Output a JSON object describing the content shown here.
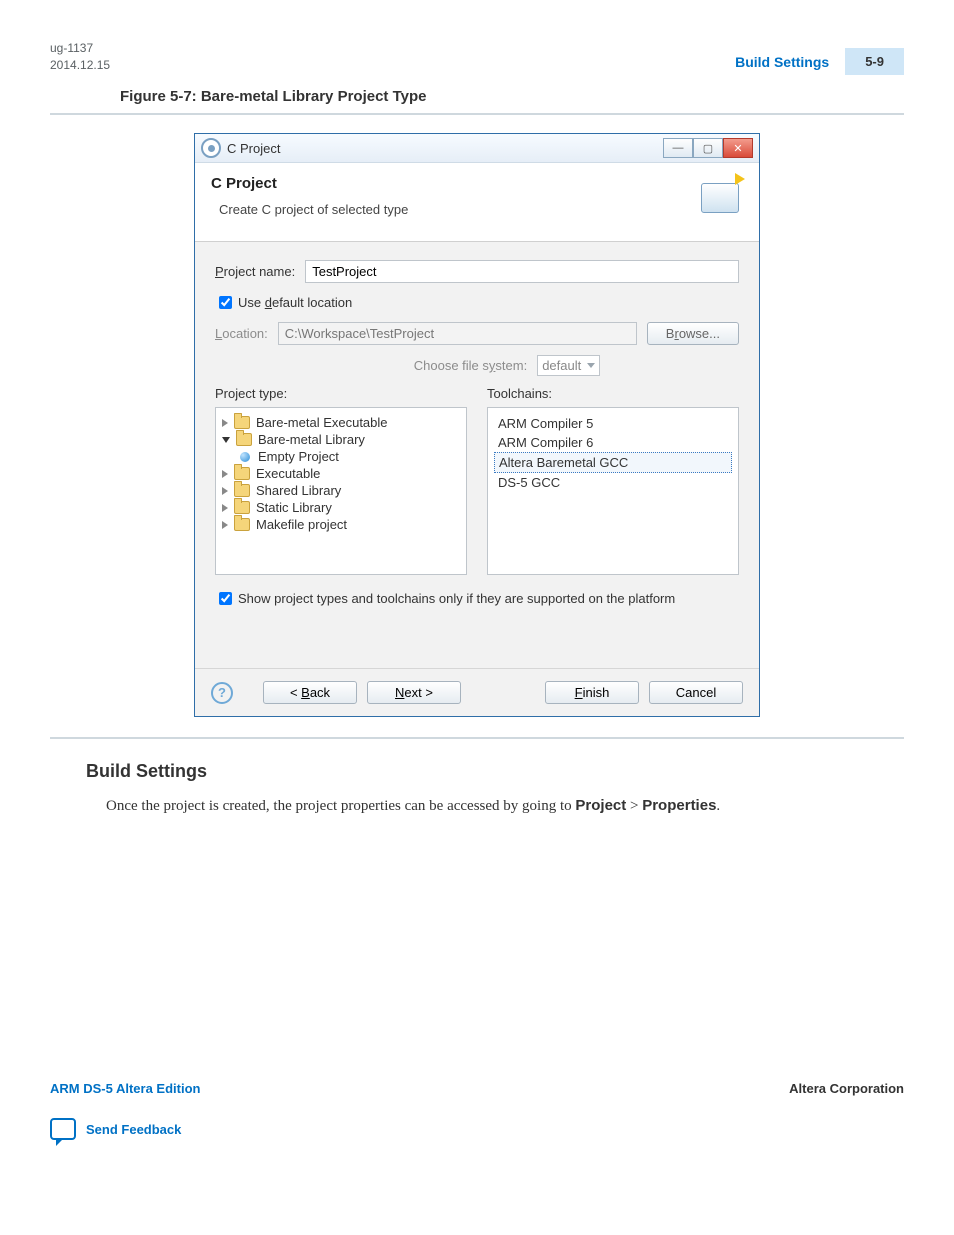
{
  "header": {
    "doc_id": "ug-1137",
    "date": "2014.12.15",
    "section_link": "Build Settings",
    "page_num": "5-9"
  },
  "figure_caption": "Figure 5-7: Bare-metal Library Project Type",
  "dialog": {
    "title": "C Project",
    "banner_title": "C Project",
    "banner_sub": "Create C project of selected type",
    "project_name_label": "Project name:",
    "project_name_value": "TestProject",
    "use_default_label": "Use default location",
    "location_label": "Location:",
    "location_value": "C:\\Workspace\\TestProject",
    "browse_label": "Browse...",
    "choose_fs_label": "Choose file system:",
    "choose_fs_value": "default",
    "project_type_label": "Project type:",
    "toolchains_label": "Toolchains:",
    "tree": {
      "bare_exec": "Bare-metal Executable",
      "bare_lib": "Bare-metal Library",
      "empty_project": "Empty Project",
      "executable": "Executable",
      "shared_lib": "Shared Library",
      "static_lib": "Static Library",
      "makefile": "Makefile project"
    },
    "toolchains": {
      "arm5": "ARM Compiler 5",
      "arm6": "ARM Compiler 6",
      "altera": "Altera Baremetal GCC",
      "ds5": "DS-5 GCC"
    },
    "filter_label": "Show project types and toolchains only if they are supported on the platform",
    "buttons": {
      "back": "< Back",
      "next": "Next >",
      "finish": "Finish",
      "cancel": "Cancel"
    }
  },
  "section_heading": "Build Settings",
  "section_body_pre": "Once the project is created, the project properties can be accessed by going to ",
  "section_body_b1": "Project",
  "section_body_gt": " > ",
  "section_body_b2": "Properties",
  "section_body_post": ".",
  "footer": {
    "left": "ARM DS-5 Altera Edition",
    "right": "Altera Corporation",
    "feedback": "Send Feedback"
  }
}
